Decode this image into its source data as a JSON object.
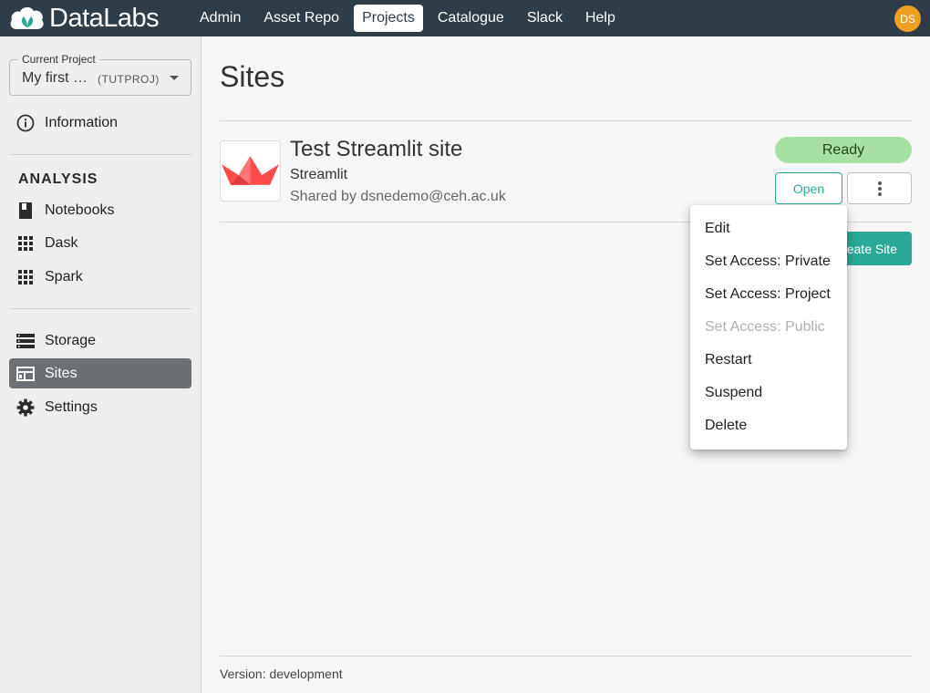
{
  "app": {
    "title": "DataLabs"
  },
  "nav": {
    "items": [
      {
        "label": "Admin"
      },
      {
        "label": "Asset Repo"
      },
      {
        "label": "Projects",
        "active": true
      },
      {
        "label": "Catalogue"
      },
      {
        "label": "Slack"
      },
      {
        "label": "Help"
      }
    ]
  },
  "user": {
    "initials": "DS",
    "avatar_color": "#f0a020"
  },
  "sidebar": {
    "project_legend": "Current Project",
    "project_name": "My first …",
    "project_key": "(TUTPROJ)",
    "information_label": "Information",
    "section_heading": "ANALYSIS",
    "analysis_items": [
      {
        "label": "Notebooks",
        "icon": "book-icon"
      },
      {
        "label": "Dask",
        "icon": "grid-icon"
      },
      {
        "label": "Spark",
        "icon": "grid-icon"
      }
    ],
    "other_items": [
      {
        "label": "Storage",
        "icon": "storage-icon"
      },
      {
        "label": "Sites",
        "icon": "web-icon",
        "active": true
      },
      {
        "label": "Settings",
        "icon": "gear-icon"
      }
    ]
  },
  "main": {
    "title": "Sites",
    "site": {
      "title": "Test Streamlit site",
      "type": "Streamlit",
      "shared_by": "Shared by dsnedemo@ceh.ac.uk",
      "status": "Ready",
      "open_label": "Open"
    },
    "create_label": "Create Site",
    "menu": [
      {
        "label": "Edit",
        "disabled": false
      },
      {
        "label": "Set Access: Private",
        "disabled": false
      },
      {
        "label": "Set Access: Project",
        "disabled": false
      },
      {
        "label": "Set Access: Public",
        "disabled": true
      },
      {
        "label": "Restart",
        "disabled": false
      },
      {
        "label": "Suspend",
        "disabled": false
      },
      {
        "label": "Delete",
        "disabled": false
      }
    ],
    "footer": "Version: development"
  },
  "colors": {
    "topbar": "#2e3d48",
    "accent": "#2ba896",
    "status_ready": "#a8e0a4",
    "streamlit_red": "#ff4b4b"
  }
}
